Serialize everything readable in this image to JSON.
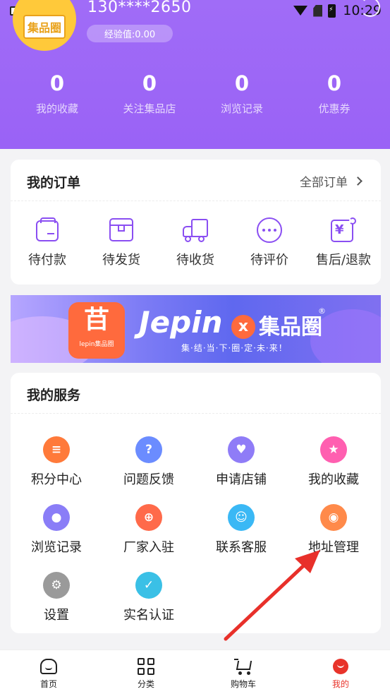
{
  "status": {
    "time": "10:29"
  },
  "profile": {
    "avatar_text": "集品圈",
    "phone": "130****2650",
    "experience": "经验值:0.00"
  },
  "stats": [
    {
      "value": "0",
      "label": "我的收藏"
    },
    {
      "value": "0",
      "label": "关注集品店"
    },
    {
      "value": "0",
      "label": "浏览记录"
    },
    {
      "value": "0",
      "label": "优惠券"
    }
  ],
  "orders": {
    "title": "我的订单",
    "all_label": "全部订单",
    "items": [
      {
        "label": "待付款",
        "icon": "wallet-icon"
      },
      {
        "label": "待发货",
        "icon": "package-icon"
      },
      {
        "label": "待收货",
        "icon": "truck-icon"
      },
      {
        "label": "待评价",
        "icon": "chat-bubble-icon"
      },
      {
        "label": "售后/退款",
        "icon": "refund-icon"
      }
    ]
  },
  "banner": {
    "brand": "Jepin",
    "brand_x": "x",
    "brand_cn": "集品圈",
    "reg": "®",
    "logo_small": "lepin集品圈",
    "slogan": "集·结·当·下·圈·定·未·来！"
  },
  "services": {
    "title": "我的服务",
    "items": [
      {
        "label": "积分中心",
        "icon": "coins-icon",
        "color": "#ff7a3a"
      },
      {
        "label": "问题反馈",
        "icon": "question-icon",
        "color": "#6b8cff"
      },
      {
        "label": "申请店铺",
        "icon": "heart-icon",
        "color": "#8f7cf7"
      },
      {
        "label": "我的收藏",
        "icon": "star-icon",
        "color": "#ff5fb0"
      },
      {
        "label": "浏览记录",
        "icon": "footprint-icon",
        "color": "#8a7df7"
      },
      {
        "label": "厂家入驻",
        "icon": "factory-icon",
        "color": "#ff6a4a"
      },
      {
        "label": "联系客服",
        "icon": "headset-icon",
        "color": "#3ab8f5"
      },
      {
        "label": "地址管理",
        "icon": "location-pin-icon",
        "color": "#ff8a4a"
      },
      {
        "label": "设置",
        "icon": "gear-icon",
        "color": "#9a9a9a"
      },
      {
        "label": "实名认证",
        "icon": "verified-icon",
        "color": "#3ac0e6"
      }
    ]
  },
  "tabbar": {
    "items": [
      {
        "label": "首页",
        "icon": "home-icon"
      },
      {
        "label": "分类",
        "icon": "grid-icon"
      },
      {
        "label": "购物车",
        "icon": "cart-icon"
      },
      {
        "label": "我的",
        "icon": "profile-icon",
        "active": true
      }
    ],
    "active_color": "#e8332a"
  },
  "colors": {
    "header": "#9d67f6",
    "accent": "#8a4ef2",
    "annotation_arrow": "#e8302a"
  }
}
